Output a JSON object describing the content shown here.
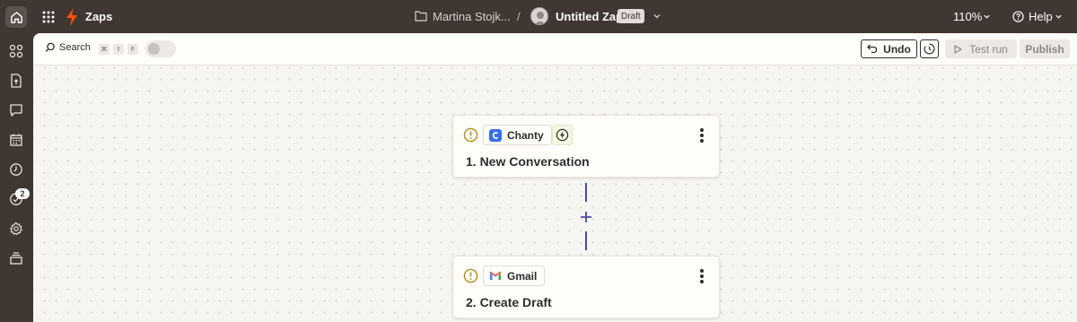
{
  "header": {
    "app_title": "Zaps",
    "owner_name": "Martina Stojk...",
    "separator": "/",
    "zap_name": "Untitled Zap",
    "status_badge": "Draft",
    "zoom": "110%",
    "help_label": "Help"
  },
  "sidebar": {
    "items": [
      {
        "icon": "apps-icon"
      },
      {
        "icon": "file-upload-icon"
      },
      {
        "icon": "chat-icon"
      },
      {
        "icon": "calendar-icon"
      },
      {
        "icon": "history-icon"
      },
      {
        "icon": "activity-icon",
        "badge": "2"
      },
      {
        "icon": "settings-icon"
      },
      {
        "icon": "stack-icon"
      }
    ]
  },
  "toolbar": {
    "search_label": "Search",
    "shortcut_keys": [
      "⌘",
      "⇧",
      "F"
    ],
    "undo_label": "Undo",
    "test_run_label": "Test run",
    "publish_label": "Publish"
  },
  "steps": [
    {
      "app": "Chanty",
      "title": "1. New Conversation",
      "is_trigger": true
    },
    {
      "app": "Gmail",
      "title": "2. Create Draft",
      "is_trigger": false
    }
  ],
  "colors": {
    "chrome": "#403632",
    "canvas": "#f7f5f2",
    "zapier_orange": "#ff4f00",
    "warning": "#b58a1b",
    "connector": "#4b4a9e",
    "chanty_blue": "#3b6fe6"
  }
}
